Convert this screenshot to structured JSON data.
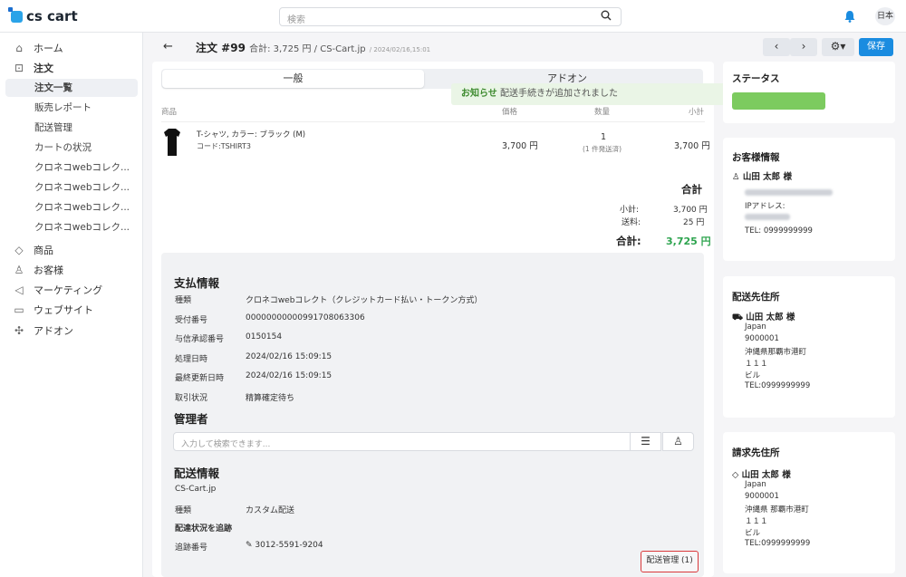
{
  "topbar": {
    "logo": "cs cart",
    "search_placeholder": "検索",
    "lang": "日本"
  },
  "sidebar": {
    "home": "ホーム",
    "orders": "注文",
    "order_sub": [
      "注文一覧",
      "販売レポート",
      "配送管理",
      "カートの状況",
      "クロネコwebコレク...",
      "クロネコwebコレク...",
      "クロネコwebコレク...",
      "クロネコwebコレク..."
    ],
    "products": "商品",
    "customers": "お客様",
    "marketing": "マーケティング",
    "website": "ウェブサイト",
    "addons": "アドオン"
  },
  "header": {
    "title": "注文 #99",
    "meta": "合計: 3,725 円 / CS-Cart.jp",
    "date": "/ 2024/02/16,15:01",
    "save_label": "保存"
  },
  "tabs": [
    "一般",
    "アドオン"
  ],
  "notice": {
    "label": "お知らせ",
    "text": "配送手続きが追加されました"
  },
  "table": {
    "headers": [
      "商品",
      "価格",
      "数量",
      "小計"
    ],
    "row": {
      "name": "T-シャツ, カラー: ブラック (M)",
      "code": "コード:TSHIRT3",
      "price": "3,700 円",
      "qty": "1",
      "qty_note": "(1 件発送済)",
      "subtotal": "3,700 円"
    }
  },
  "totals": {
    "heading": "合計",
    "subtotal_label": "小計:",
    "subtotal": "3,700 円",
    "shipping_label": "送料:",
    "shipping": "25 円",
    "grand_label": "合計:",
    "grand": "3,725 円"
  },
  "payment": {
    "heading": "支払情報",
    "rows": [
      {
        "k": "種類",
        "v": "クロネコwebコレクト（クレジットカード払い・トークン方式）"
      },
      {
        "k": "受付番号",
        "v": "00000000000991708063306"
      },
      {
        "k": "与信承認番号",
        "v": "0150154"
      },
      {
        "k": "処理日時",
        "v": "2024/02/16 15:09:15"
      },
      {
        "k": "最終更新日時",
        "v": "2024/02/16 15:09:15"
      },
      {
        "k": "取引状況",
        "v": "精算確定待ち"
      }
    ]
  },
  "admin": {
    "heading": "管理者",
    "placeholder": "入力して検索できます..."
  },
  "shipping": {
    "heading": "配送情報",
    "store": "CS-Cart.jp",
    "type_label": "種類",
    "type": "カスタム配送",
    "track_heading": "配達状況を追跡",
    "tracking_label": "追跡番号",
    "tracking": "3012-5591-9204",
    "button": "配送管理 (1)"
  },
  "status_card": {
    "heading": "ステータス"
  },
  "customer": {
    "heading": "お客様情報",
    "name": "山田 太郎 様",
    "ip_label": "IPアドレス:",
    "tel": "TEL: 0999999999"
  },
  "ship_addr": {
    "heading": "配送先住所",
    "name": "山田 太郎 様",
    "lines": [
      "Japan",
      "9000001",
      "沖縄県那覇市港町",
      "１１１",
      "ビル",
      "TEL:0999999999"
    ]
  },
  "bill_addr": {
    "heading": "請求先住所",
    "name": "山田 太郎 様",
    "lines": [
      "Japan",
      "9000001",
      "沖縄県 那覇市港町",
      "１１１",
      "ビル",
      "TEL:0999999999"
    ]
  },
  "colors": {
    "accent": "#1a8ce0",
    "success": "#2ea44f",
    "status": "#7ccb5f"
  }
}
